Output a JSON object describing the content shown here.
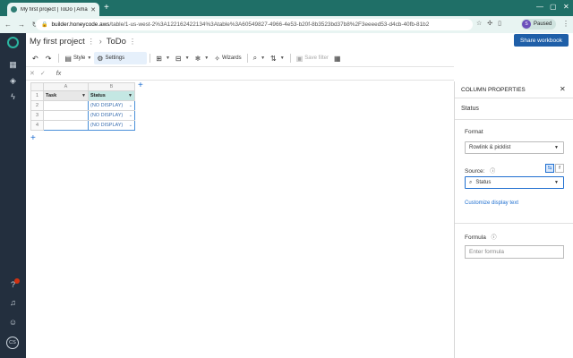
{
  "browser": {
    "tab_title": "My first project | ToDo | Amazo",
    "url_host": "builder.honeycode.aws",
    "url_path": "/table/1-us-west-2%3A122162422134%3Atable%3A60549827-4966-4e53-b20f-8b3523bd37b8%2F3eeeed53-d4cb-40fb-81b2",
    "profile_initial": "S",
    "profile_status": "Paused"
  },
  "rail": {
    "avatar_initials": "CS",
    "help_badge": "1"
  },
  "header": {
    "project": "My first project",
    "table": "ToDo",
    "share_label": "Share workbook"
  },
  "toolbar": {
    "style_label": "Style",
    "settings_label": "Settings",
    "wizards_label": "Wizards",
    "save_filter_label": "Save filter"
  },
  "formula_bar": {
    "fx_label": "fx"
  },
  "grid": {
    "column_letters": [
      "A",
      "B"
    ],
    "headers": [
      "Task",
      "Status"
    ],
    "rows": [
      {
        "num": "2",
        "task": "",
        "status": "(NO DISPLAY)"
      },
      {
        "num": "3",
        "task": "",
        "status": "(NO DISPLAY)"
      },
      {
        "num": "4",
        "task": "",
        "status": "(NO DISPLAY)"
      }
    ],
    "header_row_num": "1"
  },
  "panel": {
    "title": "COLUMN PROPERTIES",
    "column_name": "Status",
    "format_label": "Format",
    "format_value": "Rowlink & picklist",
    "source_label": "Source:",
    "source_value": "Status",
    "customize_link": "Customize display text",
    "formula_label": "Formula",
    "formula_placeholder": "Enter formula"
  }
}
